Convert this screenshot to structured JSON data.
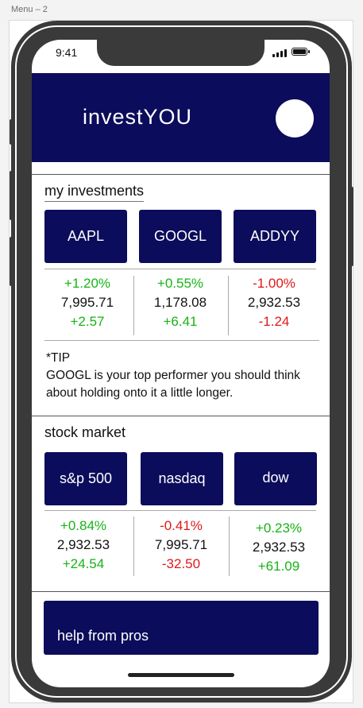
{
  "artboard": {
    "label": "Menu – 2"
  },
  "status_bar": {
    "time": "9:41"
  },
  "header": {
    "title": "investYOU"
  },
  "investments": {
    "section_title": "my investments",
    "stocks": [
      {
        "ticker": "AAPL",
        "percent": "+1.20%",
        "price": "7,995.71",
        "change": "+2.57",
        "trend": "up"
      },
      {
        "ticker": "GOOGL",
        "percent": "+0.55%",
        "price": "1,178.08",
        "change": "+6.41",
        "trend": "up"
      },
      {
        "ticker": "ADDYY",
        "percent": "-1.00%",
        "price": "2,932.53",
        "change": "-1.24",
        "trend": "down"
      }
    ],
    "tip_heading": "*TIP",
    "tip_text": "GOOGL is your top performer you should think about holding onto it a little longer."
  },
  "market": {
    "section_title": "stock market",
    "indices": [
      {
        "name": "s&p 500",
        "percent": "+0.84%",
        "price": "2,932.53",
        "change": "+24.54",
        "trend": "up"
      },
      {
        "name": "nasdaq",
        "percent": "-0.41%",
        "price": "7,995.71",
        "change": "-32.50",
        "trend": "down"
      },
      {
        "name": "dow",
        "percent": "+0.23%",
        "price": "2,932.53",
        "change": "+61.09",
        "trend": "up"
      }
    ]
  },
  "pros": {
    "label": "help from pros"
  },
  "colors": {
    "navy": "#0b0c5b",
    "up": "#17b317",
    "down": "#e01818"
  }
}
